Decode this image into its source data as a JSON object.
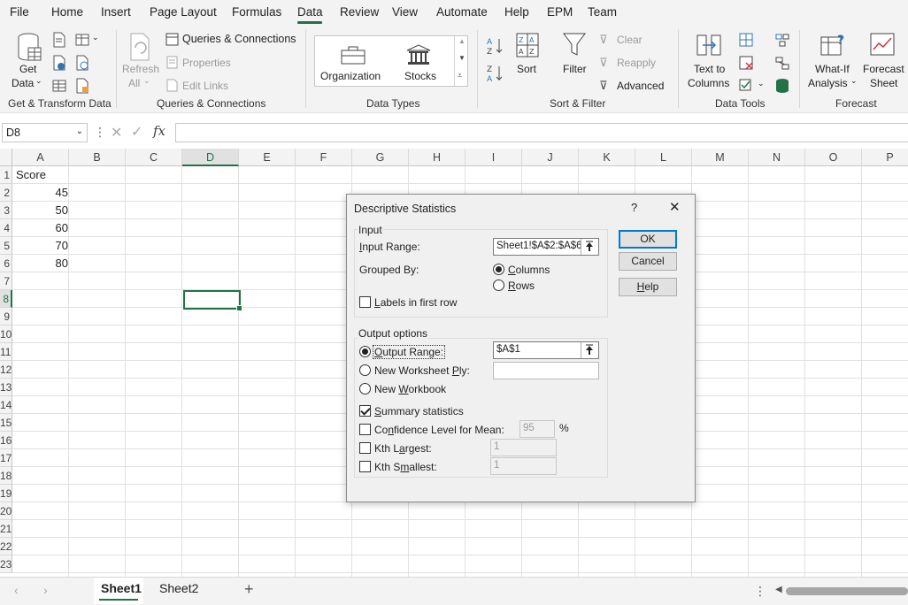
{
  "menu": {
    "items": [
      "File",
      "Home",
      "Insert",
      "Page Layout",
      "Formulas",
      "Data",
      "Review",
      "View",
      "Automate",
      "Help",
      "EPM",
      "Team"
    ],
    "active": "Data"
  },
  "ribbon": {
    "get_transform": {
      "get_data": "Get",
      "get_data2": "Data",
      "label": "Get & Transform Data"
    },
    "queries": {
      "refresh": "Refresh",
      "refresh2": "All",
      "queries_connections": "Queries & Connections",
      "properties": "Properties",
      "edit_links": "Edit Links",
      "label": "Queries & Connections"
    },
    "data_types": {
      "organization": "Organization",
      "stocks": "Stocks",
      "label": "Data Types"
    },
    "sort_filter": {
      "sort": "Sort",
      "filter": "Filter",
      "clear": "Clear",
      "reapply": "Reapply",
      "advanced": "Advanced",
      "label": "Sort & Filter"
    },
    "data_tools": {
      "text_to": "Text to",
      "columns": "Columns",
      "label": "Data Tools"
    },
    "forecast": {
      "whatif": "What-If",
      "analysis": "Analysis",
      "forecast": "Forecast",
      "sheet": "Sheet",
      "label": "Forecast"
    }
  },
  "formula_bar": {
    "name_box": "D8",
    "fx": "fx",
    "value": ""
  },
  "grid": {
    "columns": [
      "A",
      "B",
      "C",
      "D",
      "E",
      "F",
      "G",
      "H",
      "I",
      "J",
      "K",
      "L",
      "M",
      "N",
      "O",
      "P"
    ],
    "rows": [
      "1",
      "2",
      "3",
      "4",
      "5",
      "6",
      "7",
      "8",
      "9",
      "10",
      "11",
      "12",
      "13",
      "14",
      "15",
      "16",
      "17",
      "18",
      "19",
      "20",
      "21",
      "22",
      "23"
    ],
    "cells": {
      "A1": "Score",
      "A2": "45",
      "A3": "50",
      "A4": "60",
      "A5": "70",
      "A6": "80"
    },
    "selected_col": "D",
    "selected_row": "8"
  },
  "sheets": {
    "tabs": [
      "Sheet1",
      "Sheet2"
    ],
    "active": "Sheet1",
    "add": "+"
  },
  "dialog": {
    "title": "Descriptive Statistics",
    "help_q": "?",
    "close": "✕",
    "input_legend": "Input",
    "input_range_label": "Input Range:",
    "input_range_value": "Sheet1!$A$2:$A$6",
    "grouped_by_label": "Grouped By:",
    "columns_label": "Columns",
    "rows_label": "Rows",
    "labels_first_row": "Labels in first row",
    "output_legend": "Output options",
    "output_range_label": "Output Range:",
    "output_range_value": "$A$1",
    "new_ply_label": "New Worksheet Ply:",
    "new_workbook_label": "New Workbook",
    "summary_stats_label": "Summary statistics",
    "confidence_label": "Confidence Level for Mean:",
    "confidence_value": "95",
    "percent": "%",
    "kth_largest_label": "Kth Largest:",
    "kth_largest_value": "1",
    "kth_smallest_label": "Kth Smallest:",
    "kth_smallest_value": "1",
    "ok": "OK",
    "cancel": "Cancel",
    "help": "Help"
  }
}
